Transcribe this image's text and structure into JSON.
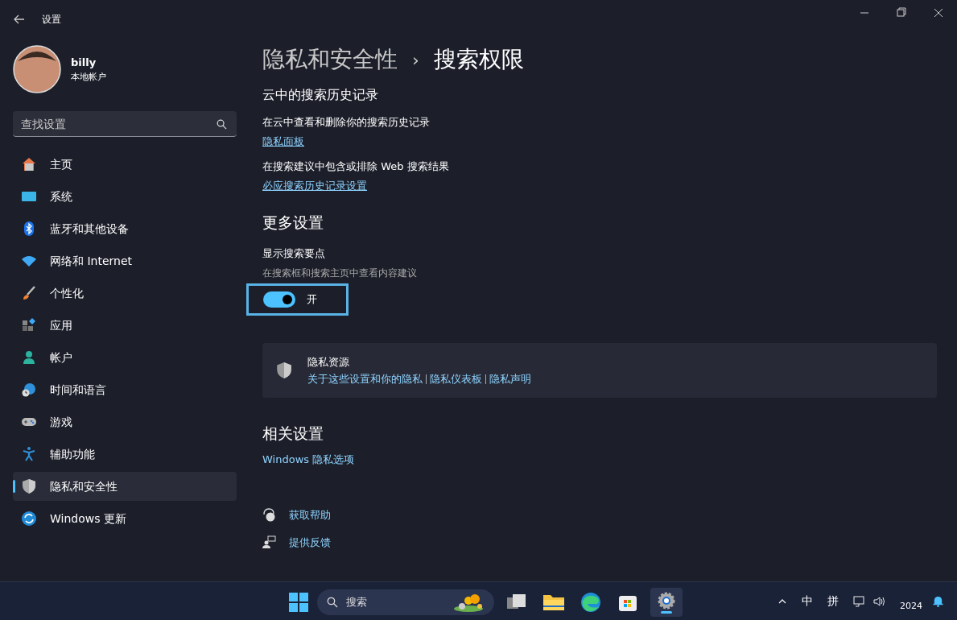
{
  "window": {
    "title": "设置"
  },
  "account": {
    "name": "billy",
    "type": "本地帐户"
  },
  "search": {
    "placeholder": "查找设置"
  },
  "sidebar": {
    "items": [
      {
        "label": "主页",
        "selected": false
      },
      {
        "label": "系统",
        "selected": false
      },
      {
        "label": "蓝牙和其他设备",
        "selected": false
      },
      {
        "label": "网络和 Internet",
        "selected": false
      },
      {
        "label": "个性化",
        "selected": false
      },
      {
        "label": "应用",
        "selected": false
      },
      {
        "label": "帐户",
        "selected": false
      },
      {
        "label": "时间和语言",
        "selected": false
      },
      {
        "label": "游戏",
        "selected": false
      },
      {
        "label": "辅助功能",
        "selected": false
      },
      {
        "label": "隐私和安全性",
        "selected": true
      },
      {
        "label": "Windows 更新",
        "selected": false
      }
    ]
  },
  "breadcrumb": {
    "parent": "隐私和安全性",
    "separator": "›",
    "current": "搜索权限"
  },
  "cloud_history": {
    "heading": "云中的搜索历史记录",
    "entries": [
      {
        "text": "在云中查看和删除你的搜索历史记录",
        "link": "隐私面板"
      },
      {
        "text": "在搜索建议中包含或排除 Web 搜索结果",
        "link": "必应搜索历史记录设置"
      }
    ]
  },
  "more_settings": {
    "heading": "更多设置",
    "setting": {
      "title": "显示搜索要点",
      "description": "在搜索框和搜索主页中查看内容建议",
      "on": true,
      "focused": true,
      "state_label": "开"
    }
  },
  "privacy_resources": {
    "title": "隐私资源",
    "links": [
      "关于这些设置和你的隐私",
      "隐私仪表板",
      "隐私声明"
    ]
  },
  "related_settings": {
    "heading": "相关设置",
    "links": [
      "Windows 隐私选项"
    ]
  },
  "help_links": [
    "获取帮助",
    "提供反馈"
  ],
  "taskbar": {
    "search_placeholder": "搜索",
    "tray": [
      "中",
      "拼"
    ],
    "clock": "2024"
  }
}
